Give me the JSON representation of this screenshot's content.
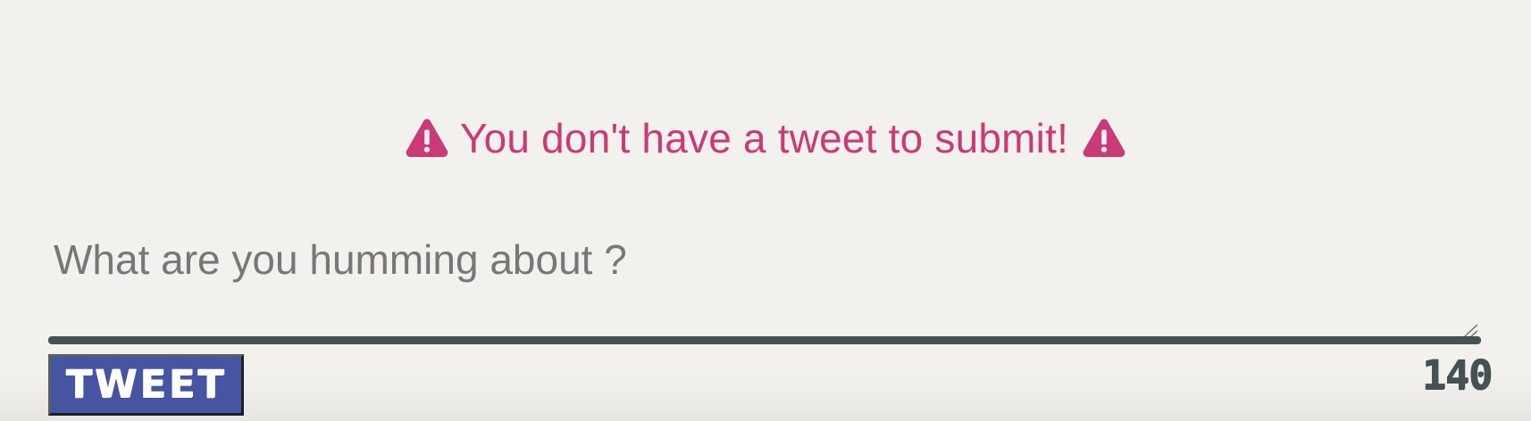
{
  "colors": {
    "page_background": "#f3f1ed",
    "error_text": "#c93a77",
    "input_placeholder": "#777777",
    "underline": "#465154",
    "button_background": "#4655a1",
    "button_text": "#ffffff",
    "counter_text": "#465154"
  },
  "alert": {
    "message": "You don't have a tweet to submit!",
    "left_icon": "warning-triangle-icon",
    "right_icon": "warning-triangle-icon"
  },
  "composer": {
    "value": "",
    "placeholder": "What are you humming about ?",
    "resize_icon": "resize-handle-icon"
  },
  "actions": {
    "tweet_button_label": "TWEET"
  },
  "counter": {
    "remaining": "140"
  }
}
